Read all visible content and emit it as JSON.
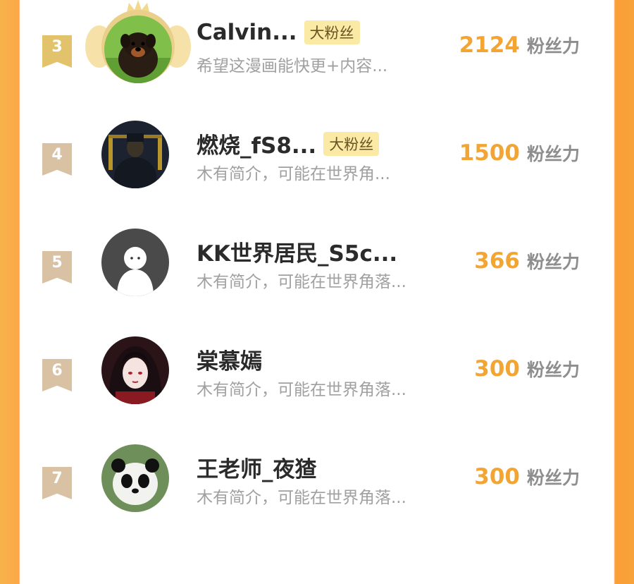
{
  "rows": [
    {
      "rank": "3",
      "name": "Calvin...",
      "badge": "大粉丝",
      "bio": "希望这漫画能快更+内容...",
      "score": "2124",
      "unit": "粉丝力",
      "avatar_icon": "rottweiler-avatar"
    },
    {
      "rank": "4",
      "name": "燃烧_fS8...",
      "badge": "大粉丝",
      "bio": "木有简介，可能在世界角...",
      "score": "1500",
      "unit": "粉丝力",
      "avatar_icon": "dark-portrait-avatar"
    },
    {
      "rank": "5",
      "name": "KK世界居民_S5c...",
      "badge": "",
      "bio": "木有简介，可能在世界角落...",
      "score": "366",
      "unit": "粉丝力",
      "avatar_icon": "default-ghost-avatar"
    },
    {
      "rank": "6",
      "name": "棠慕嫣",
      "badge": "",
      "bio": "木有简介，可能在世界角落...",
      "score": "300",
      "unit": "粉丝力",
      "avatar_icon": "anime-girl-avatar"
    },
    {
      "rank": "7",
      "name": "王老师_夜猹",
      "badge": "",
      "bio": "木有简介，可能在世界角落...",
      "score": "300",
      "unit": "粉丝力",
      "avatar_icon": "panda-avatar"
    }
  ],
  "colors": {
    "accent": "#f2a533",
    "badge_bg": "#fbeaa6",
    "frame": "#fca84a"
  }
}
